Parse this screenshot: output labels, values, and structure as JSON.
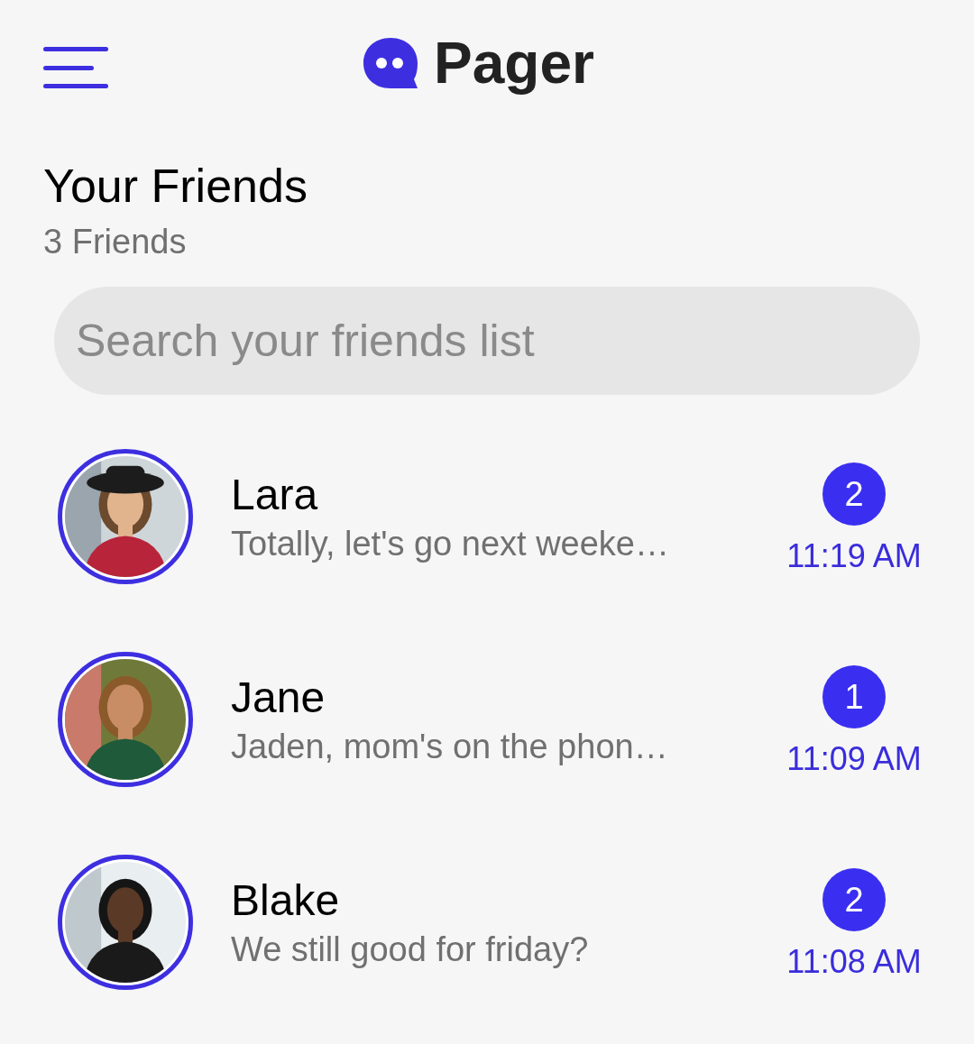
{
  "header": {
    "app_name": "Pager"
  },
  "title": "Your Friends",
  "subtitle": "3 Friends",
  "search": {
    "placeholder": "Search your friends list"
  },
  "friends": [
    {
      "name": "Lara",
      "preview": "Totally, let's go next weeke…",
      "unread": "2",
      "time": "11:19 AM"
    },
    {
      "name": "Jane",
      "preview": "Jaden, mom's on the phon…",
      "unread": "1",
      "time": "11:09 AM"
    },
    {
      "name": "Blake",
      "preview": "We still good for friday?",
      "unread": "2",
      "time": "11:08 AM"
    }
  ]
}
